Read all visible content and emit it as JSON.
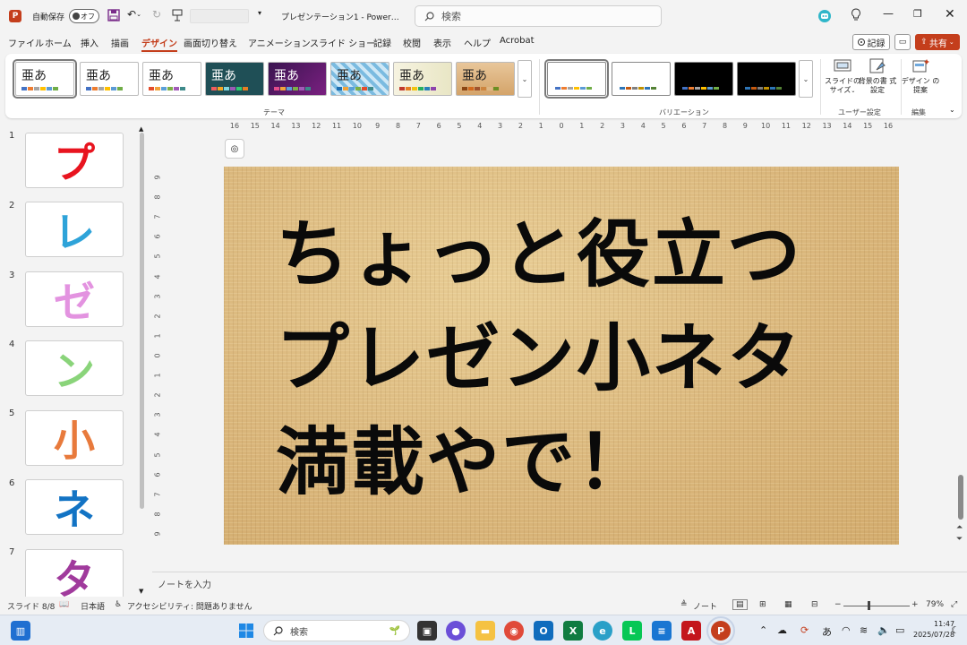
{
  "titlebar": {
    "autosave_label": "自動保存",
    "autosave_state": "オフ",
    "document_title": "プレゼンテーション1 - Power…",
    "search_placeholder": "検索"
  },
  "menu": {
    "tabs": [
      "ファイル",
      "ホーム",
      "挿入",
      "描画",
      "デザイン",
      "画面切り替え",
      "アニメーション",
      "スライド ショー",
      "記録",
      "校閲",
      "表示",
      "ヘルプ",
      "Acrobat"
    ],
    "active_tab": "デザイン",
    "record_label": "記録",
    "share_label": "共有"
  },
  "ribbon": {
    "theme_sample": "亜あ",
    "themes_group_label": "テーマ",
    "variations_group_label": "バリエーション",
    "user_settings_label": "ユーザー設定",
    "edit_label": "編集",
    "slide_size_label": "スライドの サイズ",
    "bg_format_label": "背景の書 式設定",
    "design_ideas_label": "デザイン の提案"
  },
  "ruler": {
    "horizontal": [
      "16",
      "15",
      "14",
      "13",
      "12",
      "11",
      "10",
      "9",
      "8",
      "7",
      "6",
      "5",
      "4",
      "3",
      "2",
      "1",
      "0",
      "1",
      "2",
      "3",
      "4",
      "5",
      "6",
      "7",
      "8",
      "9",
      "10",
      "11",
      "12",
      "13",
      "14",
      "15",
      "16"
    ],
    "vertical": [
      "9",
      "8",
      "7",
      "6",
      "5",
      "4",
      "3",
      "2",
      "1",
      "0",
      "1",
      "2",
      "3",
      "4",
      "5",
      "6",
      "7",
      "8",
      "9"
    ]
  },
  "thumbnails": [
    {
      "num": "1",
      "char": "プ",
      "color": "#e8141f"
    },
    {
      "num": "2",
      "char": "レ",
      "color": "#2ea3d9"
    },
    {
      "num": "3",
      "char": "ゼ",
      "color": "#e393e0"
    },
    {
      "num": "4",
      "char": "ン",
      "color": "#8ad47a"
    },
    {
      "num": "5",
      "char": "小",
      "color": "#e87a3c"
    },
    {
      "num": "6",
      "char": "ネ",
      "color": "#1273c4"
    },
    {
      "num": "7",
      "char": "タ",
      "color": "#a03a9c"
    }
  ],
  "slide": {
    "lines": [
      "ちょっと役立つ",
      "プレゼン小ネタ",
      "満載やで！"
    ]
  },
  "notes_placeholder": "ノートを入力",
  "status": {
    "slide_count": "スライド 8/8",
    "language": "日本語",
    "accessibility": "アクセシビリティ: 問題ありません",
    "notes_button": "ノート",
    "zoom": "79%"
  },
  "taskbar": {
    "search_placeholder": "検索",
    "ime": "あ",
    "time": "11:47",
    "date": "2025/07/28"
  },
  "colors": {
    "accent": "#c43e1c",
    "slide_bg": "#dcb97a"
  }
}
